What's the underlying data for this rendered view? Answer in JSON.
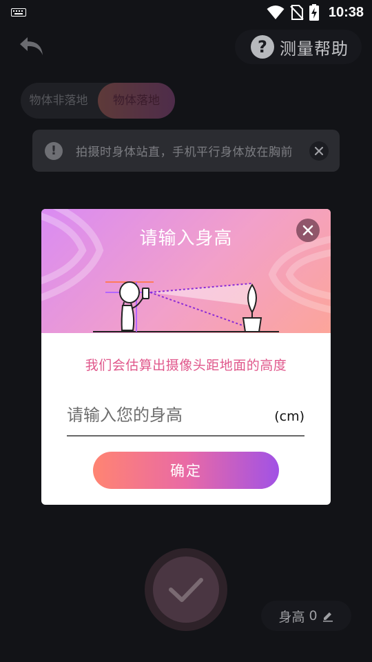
{
  "status_bar": {
    "time": "10:38"
  },
  "top_bar": {
    "help_label": "测量帮助"
  },
  "mode_toggle": {
    "option_off": "物体非落地",
    "option_on": "物体落地",
    "selected": "物体落地"
  },
  "tip": {
    "text": "拍摄时身体站直，手机平行身体放在胸前"
  },
  "modal": {
    "title": "请输入身高",
    "subtitle": "我们会估算出摄像头距地面的高度",
    "input_placeholder": "请输入您的身高",
    "input_value": "",
    "unit": "(cm)",
    "confirm_label": "确定"
  },
  "height_chip": {
    "label": "身高",
    "value": "0"
  },
  "colors": {
    "accent_gradient_start": "#ff8472",
    "accent_gradient_end": "#a152e5",
    "subtitle_pink": "#e0578b"
  }
}
